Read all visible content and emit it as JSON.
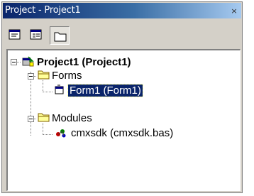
{
  "window": {
    "title": "Project - Project1",
    "close_glyph": "×"
  },
  "toolbar": {
    "buttons": [
      {
        "icon": "view-code-icon"
      },
      {
        "icon": "view-object-icon"
      },
      {
        "icon": "toggle-folders-icon",
        "pressed": true
      }
    ]
  },
  "tree": {
    "project": {
      "label": "Project1 (Project1)",
      "expanded": true
    },
    "forms_folder": {
      "label": "Forms",
      "expanded": true
    },
    "form1": {
      "label": "Form1 (Form1)",
      "selected": true
    },
    "modules_folder": {
      "label": "Modules",
      "expanded": true
    },
    "module1": {
      "label": "cmxsdk (cmxsdk.bas)"
    }
  },
  "colors": {
    "titlebar": "#0a246a",
    "selection": "#0a246a",
    "face": "#d4d0c8"
  }
}
